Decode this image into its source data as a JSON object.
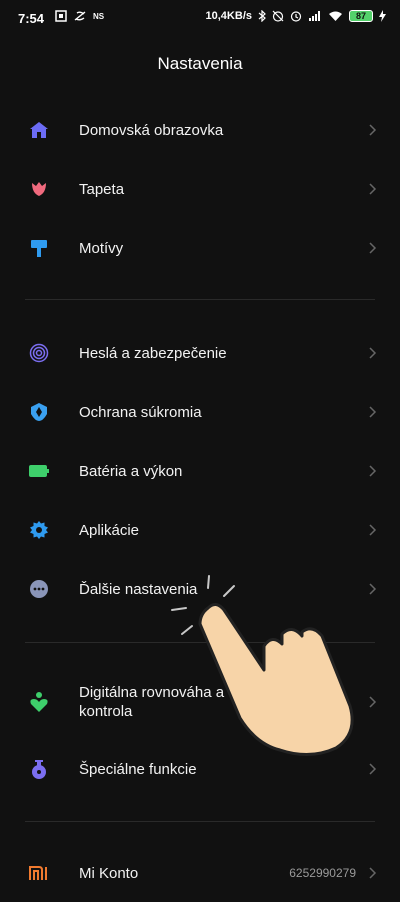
{
  "status_bar": {
    "time": "7:54",
    "left_icons": [
      "sim-icon",
      "data-saver-icon",
      "ns-badge"
    ],
    "ns_text": "NS",
    "network_speed": "10,4KB/s",
    "right_icons": [
      "bluetooth-icon",
      "alarm-off-icon",
      "alarm-icon",
      "signal-icon",
      "wifi-icon",
      "battery-icon",
      "charging-icon"
    ],
    "battery_level": "87"
  },
  "header": {
    "title": "Nastavenia"
  },
  "sections": [
    {
      "items": [
        {
          "label": "Domovská obrazovka",
          "icon": "home-icon",
          "color": "#6c6cf5"
        },
        {
          "label": "Tapeta",
          "icon": "tulip-icon",
          "color": "#f06a7e"
        },
        {
          "label": "Motívy",
          "icon": "paint-roller-icon",
          "color": "#2f9bf0"
        }
      ]
    },
    {
      "items": [
        {
          "label": "Heslá a zabezpečenie",
          "icon": "fingerprint-icon",
          "color": "#7b6ef0"
        },
        {
          "label": "Ochrana súkromia",
          "icon": "privacy-shield-icon",
          "color": "#3aa0f0"
        },
        {
          "label": "Batéria a výkon",
          "icon": "battery-performance-icon",
          "color": "#3ecf6b"
        },
        {
          "label": "Aplikácie",
          "icon": "gear-icon",
          "color": "#2f9bf0"
        },
        {
          "label": "Ďalšie nastavenia",
          "icon": "more-dots-icon",
          "color": "#8a95b8"
        }
      ]
    },
    {
      "items": [
        {
          "label": "Digitálna rovnováha a rodičovská kontrola",
          "label_line1": "Digitálna rovnováha a",
          "label_line2": "kontrola",
          "icon": "digital-wellbeing-icon",
          "color": "#3ecf6b"
        },
        {
          "label": "Špeciálne funkcie",
          "icon": "special-features-icon",
          "color": "#7b6ef0"
        }
      ]
    },
    {
      "items": [
        {
          "label": "Mi Konto",
          "icon": "mi-logo-icon",
          "color": "#f07a2f",
          "value": "6252990279"
        }
      ]
    }
  ],
  "overlay": {
    "icon": "tap-hand-icon",
    "skin_color": "#f7d4a8"
  }
}
